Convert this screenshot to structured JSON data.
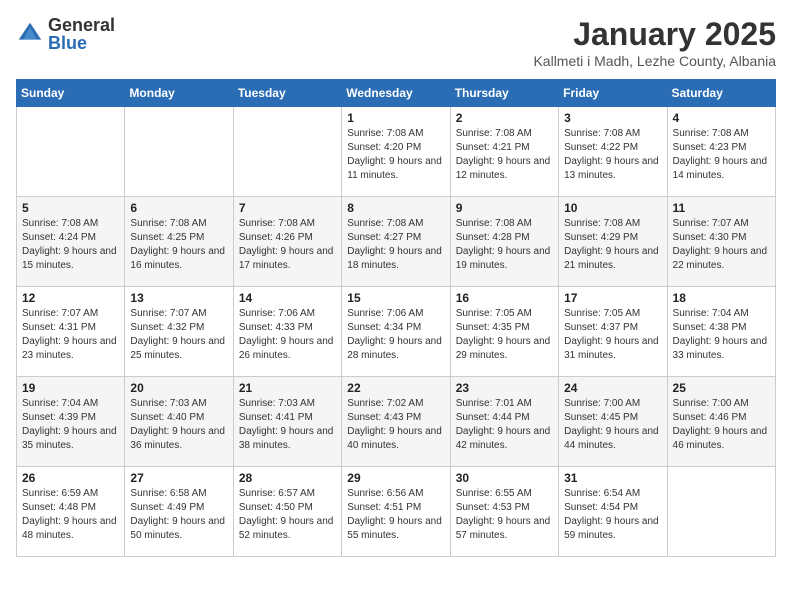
{
  "logo": {
    "general": "General",
    "blue": "Blue"
  },
  "title": "January 2025",
  "subtitle": "Kallmeti i Madh, Lezhe County, Albania",
  "days_of_week": [
    "Sunday",
    "Monday",
    "Tuesday",
    "Wednesday",
    "Thursday",
    "Friday",
    "Saturday"
  ],
  "weeks": [
    [
      null,
      null,
      null,
      {
        "day": 1,
        "sunrise": "7:08 AM",
        "sunset": "4:20 PM",
        "daylight": "9 hours and 11 minutes."
      },
      {
        "day": 2,
        "sunrise": "7:08 AM",
        "sunset": "4:21 PM",
        "daylight": "9 hours and 12 minutes."
      },
      {
        "day": 3,
        "sunrise": "7:08 AM",
        "sunset": "4:22 PM",
        "daylight": "9 hours and 13 minutes."
      },
      {
        "day": 4,
        "sunrise": "7:08 AM",
        "sunset": "4:23 PM",
        "daylight": "9 hours and 14 minutes."
      }
    ],
    [
      {
        "day": 5,
        "sunrise": "7:08 AM",
        "sunset": "4:24 PM",
        "daylight": "9 hours and 15 minutes."
      },
      {
        "day": 6,
        "sunrise": "7:08 AM",
        "sunset": "4:25 PM",
        "daylight": "9 hours and 16 minutes."
      },
      {
        "day": 7,
        "sunrise": "7:08 AM",
        "sunset": "4:26 PM",
        "daylight": "9 hours and 17 minutes."
      },
      {
        "day": 8,
        "sunrise": "7:08 AM",
        "sunset": "4:27 PM",
        "daylight": "9 hours and 18 minutes."
      },
      {
        "day": 9,
        "sunrise": "7:08 AM",
        "sunset": "4:28 PM",
        "daylight": "9 hours and 19 minutes."
      },
      {
        "day": 10,
        "sunrise": "7:08 AM",
        "sunset": "4:29 PM",
        "daylight": "9 hours and 21 minutes."
      },
      {
        "day": 11,
        "sunrise": "7:07 AM",
        "sunset": "4:30 PM",
        "daylight": "9 hours and 22 minutes."
      }
    ],
    [
      {
        "day": 12,
        "sunrise": "7:07 AM",
        "sunset": "4:31 PM",
        "daylight": "9 hours and 23 minutes."
      },
      {
        "day": 13,
        "sunrise": "7:07 AM",
        "sunset": "4:32 PM",
        "daylight": "9 hours and 25 minutes."
      },
      {
        "day": 14,
        "sunrise": "7:06 AM",
        "sunset": "4:33 PM",
        "daylight": "9 hours and 26 minutes."
      },
      {
        "day": 15,
        "sunrise": "7:06 AM",
        "sunset": "4:34 PM",
        "daylight": "9 hours and 28 minutes."
      },
      {
        "day": 16,
        "sunrise": "7:05 AM",
        "sunset": "4:35 PM",
        "daylight": "9 hours and 29 minutes."
      },
      {
        "day": 17,
        "sunrise": "7:05 AM",
        "sunset": "4:37 PM",
        "daylight": "9 hours and 31 minutes."
      },
      {
        "day": 18,
        "sunrise": "7:04 AM",
        "sunset": "4:38 PM",
        "daylight": "9 hours and 33 minutes."
      }
    ],
    [
      {
        "day": 19,
        "sunrise": "7:04 AM",
        "sunset": "4:39 PM",
        "daylight": "9 hours and 35 minutes."
      },
      {
        "day": 20,
        "sunrise": "7:03 AM",
        "sunset": "4:40 PM",
        "daylight": "9 hours and 36 minutes."
      },
      {
        "day": 21,
        "sunrise": "7:03 AM",
        "sunset": "4:41 PM",
        "daylight": "9 hours and 38 minutes."
      },
      {
        "day": 22,
        "sunrise": "7:02 AM",
        "sunset": "4:43 PM",
        "daylight": "9 hours and 40 minutes."
      },
      {
        "day": 23,
        "sunrise": "7:01 AM",
        "sunset": "4:44 PM",
        "daylight": "9 hours and 42 minutes."
      },
      {
        "day": 24,
        "sunrise": "7:00 AM",
        "sunset": "4:45 PM",
        "daylight": "9 hours and 44 minutes."
      },
      {
        "day": 25,
        "sunrise": "7:00 AM",
        "sunset": "4:46 PM",
        "daylight": "9 hours and 46 minutes."
      }
    ],
    [
      {
        "day": 26,
        "sunrise": "6:59 AM",
        "sunset": "4:48 PM",
        "daylight": "9 hours and 48 minutes."
      },
      {
        "day": 27,
        "sunrise": "6:58 AM",
        "sunset": "4:49 PM",
        "daylight": "9 hours and 50 minutes."
      },
      {
        "day": 28,
        "sunrise": "6:57 AM",
        "sunset": "4:50 PM",
        "daylight": "9 hours and 52 minutes."
      },
      {
        "day": 29,
        "sunrise": "6:56 AM",
        "sunset": "4:51 PM",
        "daylight": "9 hours and 55 minutes."
      },
      {
        "day": 30,
        "sunrise": "6:55 AM",
        "sunset": "4:53 PM",
        "daylight": "9 hours and 57 minutes."
      },
      {
        "day": 31,
        "sunrise": "6:54 AM",
        "sunset": "4:54 PM",
        "daylight": "9 hours and 59 minutes."
      },
      null
    ]
  ],
  "daylight_label": "Daylight:",
  "sunrise_label": "Sunrise:",
  "sunset_label": "Sunset:"
}
